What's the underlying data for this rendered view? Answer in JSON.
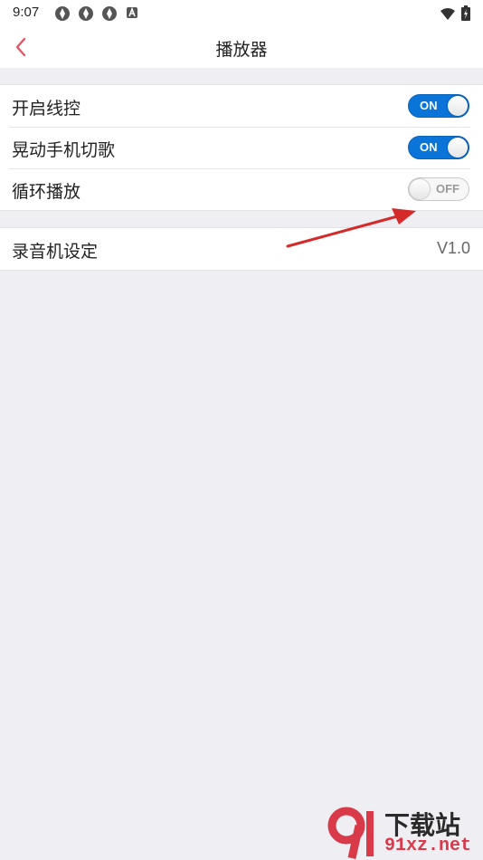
{
  "status_bar": {
    "time": "9:07"
  },
  "header": {
    "title": "播放器"
  },
  "settings": [
    {
      "label": "开启线控",
      "toggle": "ON",
      "on": true
    },
    {
      "label": "晃动手机切歌",
      "toggle": "ON",
      "on": true
    },
    {
      "label": "循环播放",
      "toggle": "OFF",
      "on": false
    }
  ],
  "recorder": {
    "label": "录音机设定",
    "value": "V1.0"
  },
  "watermark": {
    "title": "下载站",
    "domain": "91xz.net"
  },
  "colors": {
    "accent": "#0a74d8",
    "back": "#e05766",
    "annotation_arrow": "#d42a2a"
  }
}
